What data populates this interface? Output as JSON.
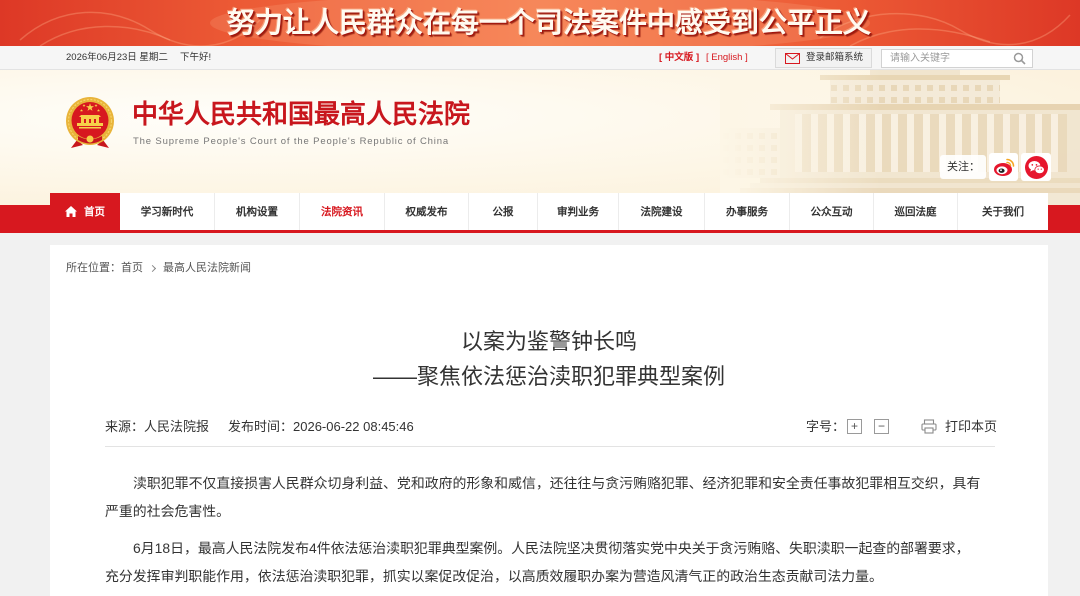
{
  "banner": {
    "slogan": "努力让人民群众在每一个司法案件中感受到公平正义"
  },
  "topbar": {
    "date": "2026年06月23日 星期二",
    "greeting": "下午好!",
    "lang_cn": "[ 中文版 ]",
    "lang_en": "[ English ]",
    "mail_icon": "envelope-icon",
    "mail_label": "登录邮箱系统",
    "search_placeholder": "请输入关键字",
    "search_icon": "search-icon"
  },
  "header": {
    "emblem_icon": "national-emblem-icon",
    "title": "中华人民共和国最高人民法院",
    "subtitle": "The Supreme People's Court of the People's Republic of China",
    "follow_label": "关注：",
    "social_icons": [
      "weibo-icon",
      "wechat-icon"
    ]
  },
  "nav": {
    "home_icon": "home-icon",
    "items": [
      "首页",
      "学习新时代",
      "机构设置",
      "法院资讯",
      "权威发布",
      "公报",
      "审判业务",
      "法院建设",
      "办事服务",
      "公众互动",
      "巡回法庭",
      "关于我们"
    ],
    "current_section": "法院资讯"
  },
  "breadcrumb": {
    "prefix": "所在位置：",
    "separator_icon": "chevron-right-icon",
    "items": [
      "首页",
      "最高人民法院新闻"
    ]
  },
  "article": {
    "title": "以案为鉴警钟长鸣",
    "subtitle": "——聚焦依法惩治渎职犯罪典型案例",
    "source_label": "来源：",
    "source": "人民法院报",
    "time_label": "发布时间：",
    "time": "2026-06-22 08:45:46",
    "font_size_label": "字号：",
    "font_increase": "+",
    "font_decrease": "−",
    "print_icon": "printer-icon",
    "print_label": "打印本页",
    "paragraphs": [
      [
        "渎职犯罪不仅直接损害人民群众切身利益、党和政府的形象和威信，还往往与贪污贿赂犯罪、经济犯罪和安全责任事故犯罪相互交织，具有",
        "严重的社会危害性。"
      ],
      [
        "6月18日，最高人民法院发布4件依法惩治渎职犯罪典型案例。人民法院坚决贯彻落实党中央关于贪污贿赂、失职渎职一起查的部署要求，",
        "充分发挥审判职能作用，依法惩治渎职犯罪，抓实以案促改促治，以高质效履职办案为营造风清气正的政治生态贡献司法力量。"
      ]
    ]
  },
  "colors": {
    "brand_red": "#d7181f",
    "title_red": "#c8161d",
    "banner_orange": "#f57b4c",
    "header_cream": "#fdf6e6",
    "text": "#333333",
    "page_bg": "#f1f1f1"
  }
}
